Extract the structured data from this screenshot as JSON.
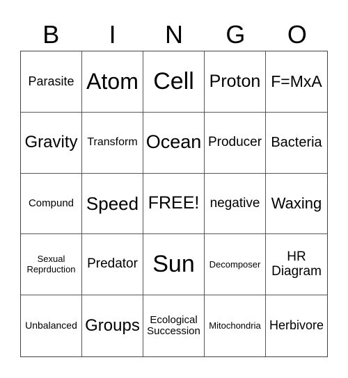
{
  "header": [
    "B",
    "I",
    "N",
    "G",
    "O"
  ],
  "cells": [
    {
      "text": "Parasite",
      "size": 18
    },
    {
      "text": "Atom",
      "size": 32
    },
    {
      "text": "Cell",
      "size": 34
    },
    {
      "text": "Proton",
      "size": 25
    },
    {
      "text": "F=MxA",
      "size": 23
    },
    {
      "text": "Gravity",
      "size": 24
    },
    {
      "text": "Transform",
      "size": 16
    },
    {
      "text": "Ocean",
      "size": 27
    },
    {
      "text": "Producer",
      "size": 19
    },
    {
      "text": "Bacteria",
      "size": 20
    },
    {
      "text": "Compund",
      "size": 15
    },
    {
      "text": "Speed",
      "size": 26
    },
    {
      "text": "FREE!",
      "size": 25
    },
    {
      "text": "negative",
      "size": 19
    },
    {
      "text": "Waxing",
      "size": 22
    },
    {
      "text": "Sexual\nReprduction",
      "size": 13
    },
    {
      "text": "Predator",
      "size": 19
    },
    {
      "text": "Sun",
      "size": 34
    },
    {
      "text": "Decomposer",
      "size": 13
    },
    {
      "text": "HR\nDiagram",
      "size": 19
    },
    {
      "text": "Unbalanced",
      "size": 14
    },
    {
      "text": "Groups",
      "size": 24
    },
    {
      "text": "Ecological\nSuccession",
      "size": 15
    },
    {
      "text": "Mitochondria",
      "size": 13
    },
    {
      "text": "Herbivore",
      "size": 18
    }
  ]
}
